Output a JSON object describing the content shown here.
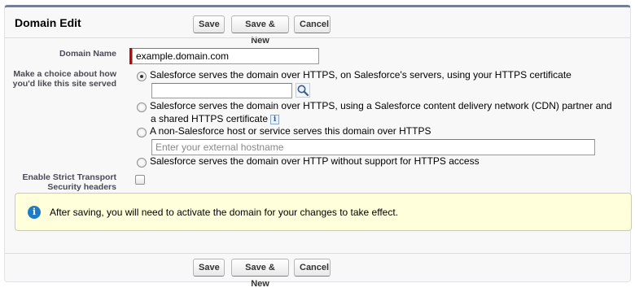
{
  "page": {
    "title": "Domain Edit"
  },
  "buttons": {
    "save": "Save",
    "save_new": "Save & New",
    "cancel": "Cancel"
  },
  "form": {
    "domain_name": {
      "label": "Domain Name",
      "value": "example.domain.com"
    },
    "serving_choice": {
      "label": "Make a choice about how you'd like this site served",
      "options": [
        {
          "label": "Salesforce serves the domain over HTTPS, on Salesforce's servers, using your HTTPS certificate",
          "selected": true
        },
        {
          "label_line1": "Salesforce serves the domain over HTTPS, using a Salesforce content delivery network (CDN) partner and",
          "label_line2": "a shared HTTPS certificate",
          "selected": false
        },
        {
          "label": "A non-Salesforce host or service serves this domain over HTTPS",
          "selected": false
        },
        {
          "label": "Salesforce serves the domain over HTTP without support for HTTPS access",
          "selected": false
        }
      ],
      "certificate_lookup_value": "",
      "external_hostname_placeholder": "Enter your external hostname"
    },
    "hsts": {
      "label": "Enable Strict Transport Security headers",
      "checked": false
    }
  },
  "notice": {
    "text": "After saving, you will need to activate the domain for your changes to take effect."
  },
  "icons": {
    "lookup": "magnifier-icon",
    "info": "info-icon"
  },
  "colors": {
    "header_border": "#747e96",
    "required": "#cc0000",
    "notice_bg": "#ffffdc",
    "notice_icon": "#1e7cc7"
  }
}
